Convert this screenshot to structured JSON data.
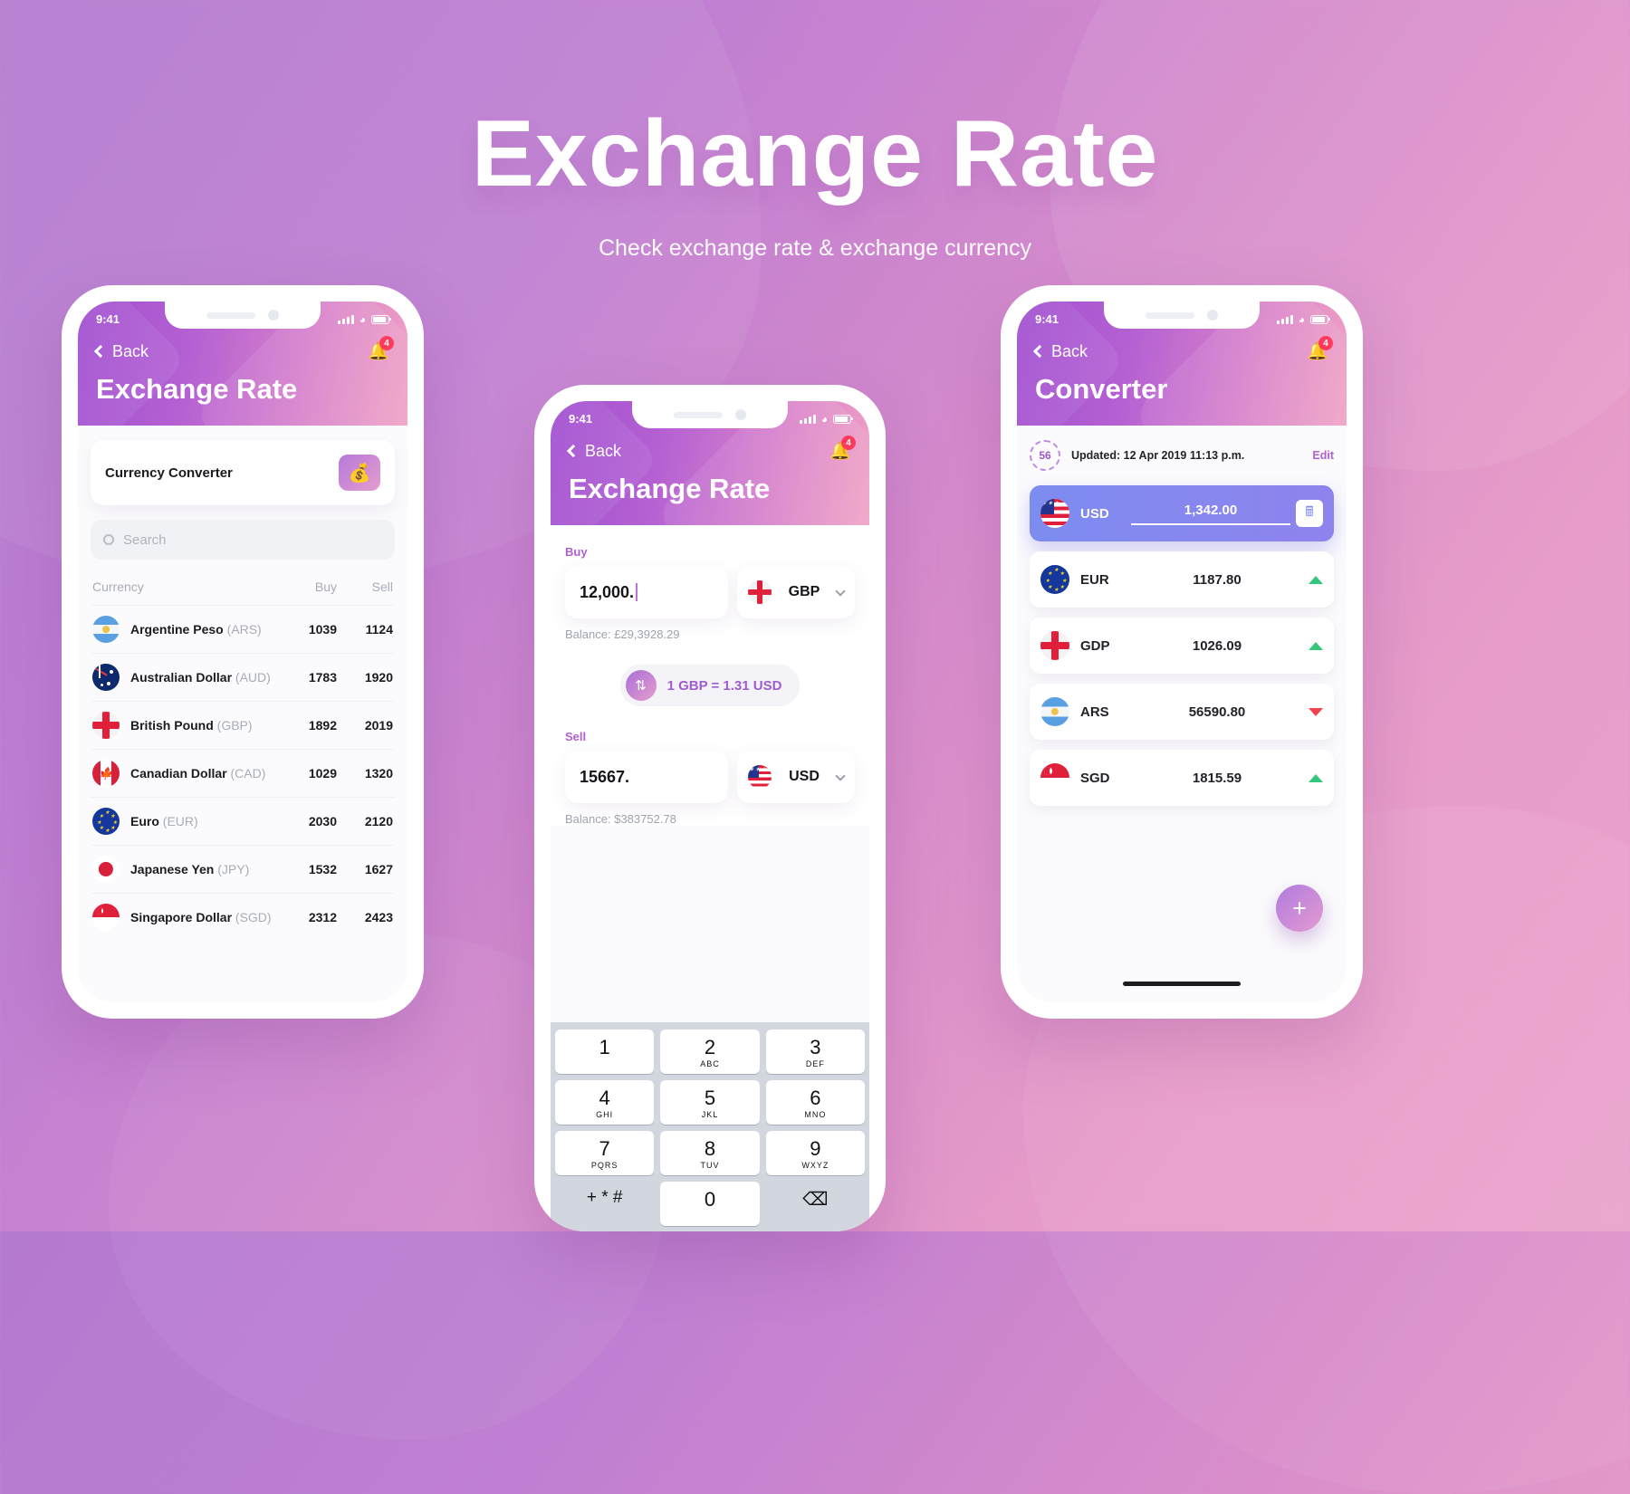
{
  "header": {
    "title": "Exchange Rate",
    "subtitle": "Check exchange rate & exchange currency"
  },
  "phone1": {
    "status": {
      "time": "9:41"
    },
    "nav": {
      "back_label": "Back",
      "notification_count": "4"
    },
    "app_title": "Exchange Rate",
    "converter_card": {
      "label": "Currency Converter"
    },
    "search": {
      "placeholder": "Search"
    },
    "table": {
      "columns": [
        "Currency",
        "Buy",
        "Sell"
      ],
      "rows": [
        {
          "flag": "ars-flag",
          "name": "Argentine Peso",
          "code": "(ARS)",
          "buy": "1039",
          "sell": "1124"
        },
        {
          "flag": "aud-flag",
          "name": "Australian Dollar",
          "code": "(AUD)",
          "buy": "1783",
          "sell": "1920"
        },
        {
          "flag": "gbp-flag",
          "name": "British Pound",
          "code": "(GBP)",
          "buy": "1892",
          "sell": "2019"
        },
        {
          "flag": "cad-flag",
          "name": "Canadian Dollar",
          "code": "(CAD)",
          "buy": "1029",
          "sell": "1320"
        },
        {
          "flag": "eur-flag",
          "name": "Euro",
          "code": "(EUR)",
          "buy": "2030",
          "sell": "2120"
        },
        {
          "flag": "jpy-flag",
          "name": "Japanese Yen",
          "code": "(JPY)",
          "buy": "1532",
          "sell": "1627"
        },
        {
          "flag": "sgd-flag",
          "name": "Singapore Dollar",
          "code": "(SGD)",
          "buy": "2312",
          "sell": "2423"
        }
      ]
    }
  },
  "phone2": {
    "status": {
      "time": "9:41"
    },
    "nav": {
      "back_label": "Back",
      "notification_count": "4"
    },
    "app_title": "Exchange Rate",
    "buy": {
      "label": "Buy",
      "amount": "12,000.",
      "currency": "GBP",
      "balance": "Balance: £29,3928.29"
    },
    "rate": {
      "text": "1 GBP = 1.31 USD"
    },
    "sell": {
      "label": "Sell",
      "amount": "15667.",
      "currency": "USD",
      "balance": "Balance: $383752.78"
    },
    "keypad": [
      {
        "num": "1",
        "sub": ""
      },
      {
        "num": "2",
        "sub": "ABC"
      },
      {
        "num": "3",
        "sub": "DEF"
      },
      {
        "num": "4",
        "sub": "GHI"
      },
      {
        "num": "5",
        "sub": "JKL"
      },
      {
        "num": "6",
        "sub": "MNO"
      },
      {
        "num": "7",
        "sub": "PQRS"
      },
      {
        "num": "8",
        "sub": "TUV"
      },
      {
        "num": "9",
        "sub": "WXYZ"
      },
      {
        "num": "+ * #",
        "sub": ""
      },
      {
        "num": "0",
        "sub": ""
      },
      {
        "num": "⌫",
        "sub": ""
      }
    ]
  },
  "phone3": {
    "status": {
      "time": "9:41"
    },
    "nav": {
      "back_label": "Back",
      "notification_count": "4"
    },
    "app_title": "Converter",
    "meta": {
      "counter": "56",
      "updated": "Updated: 12 Apr 2019  11:13 p.m.",
      "edit_label": "Edit"
    },
    "rows": [
      {
        "flag": "usd-flag",
        "code": "USD",
        "value": "1,342.00",
        "trend": "",
        "active": true
      },
      {
        "flag": "eur-flag",
        "code": "EUR",
        "value": "1187.80",
        "trend": "up",
        "active": false
      },
      {
        "flag": "gbp-flag",
        "code": "GDP",
        "value": "1026.09",
        "trend": "up",
        "active": false
      },
      {
        "flag": "ars-flag",
        "code": "ARS",
        "value": "56590.80",
        "trend": "down",
        "active": false
      },
      {
        "flag": "sgd-flag",
        "code": "SGD",
        "value": "1815.59",
        "trend": "up",
        "active": false
      }
    ],
    "fab": {
      "label": "+"
    }
  },
  "colors": {
    "accent_purple": "#a14fd0",
    "accent_pink": "#f0a2c4",
    "active_blue": "#7d8cf0",
    "up_green": "#34c77b",
    "down_red": "#f0434f",
    "badge_red": "#ff3b5c"
  }
}
